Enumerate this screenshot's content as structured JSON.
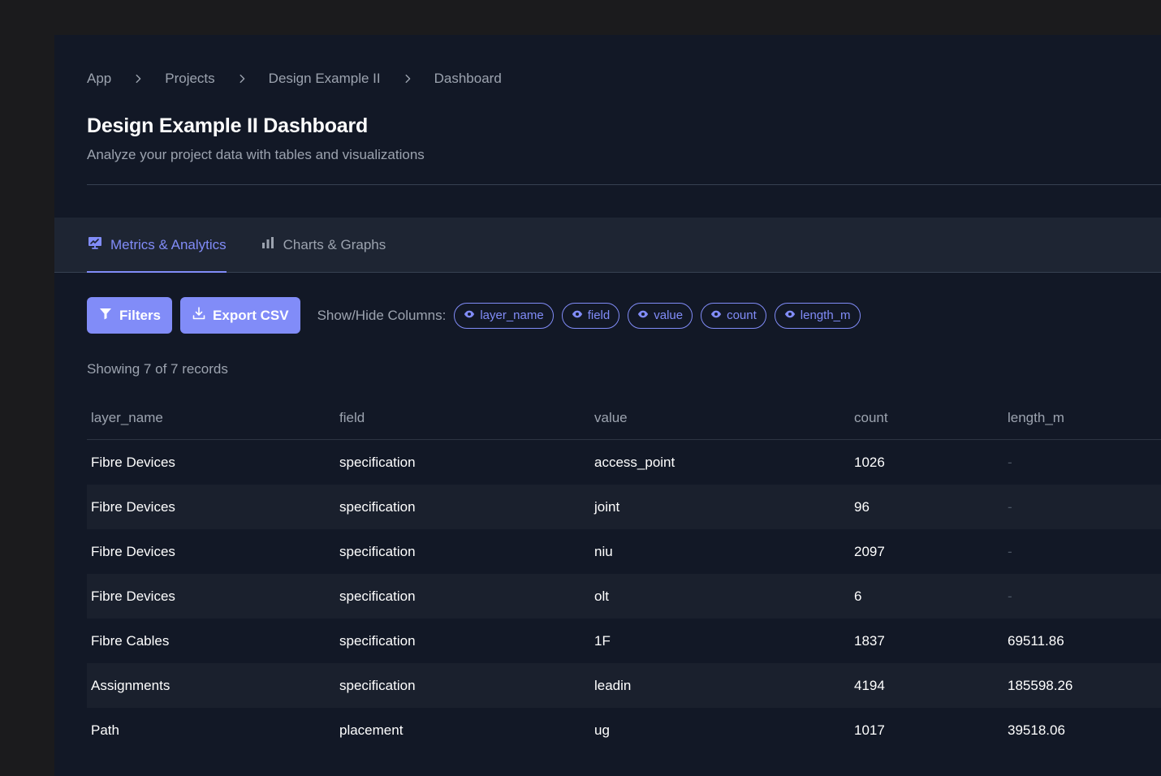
{
  "breadcrumb": [
    "App",
    "Projects",
    "Design Example II",
    "Dashboard"
  ],
  "page": {
    "title": "Design Example II Dashboard",
    "subtitle": "Analyze your project data with tables and visualizations"
  },
  "tabs": [
    {
      "label": "Metrics & Analytics",
      "active": true,
      "icon": "presentation-chart-icon"
    },
    {
      "label": "Charts & Graphs",
      "active": false,
      "icon": "bar-chart-icon"
    }
  ],
  "toolbar": {
    "filters_label": "Filters",
    "export_label": "Export CSV",
    "show_hide_label": "Show/Hide Columns:",
    "column_toggles": [
      "layer_name",
      "field",
      "value",
      "count",
      "length_m"
    ]
  },
  "records_text": "Showing 7 of 7 records",
  "table": {
    "columns": [
      "layer_name",
      "field",
      "value",
      "count",
      "length_m"
    ],
    "rows": [
      [
        "Fibre Devices",
        "specification",
        "access_point",
        "1026",
        "-"
      ],
      [
        "Fibre Devices",
        "specification",
        "joint",
        "96",
        "-"
      ],
      [
        "Fibre Devices",
        "specification",
        "niu",
        "2097",
        "-"
      ],
      [
        "Fibre Devices",
        "specification",
        "olt",
        "6",
        "-"
      ],
      [
        "Fibre Cables",
        "specification",
        "1F",
        "1837",
        "69511.86"
      ],
      [
        "Assignments",
        "specification",
        "leadin",
        "4194",
        "185598.26"
      ],
      [
        "Path",
        "placement",
        "ug",
        "1017",
        "39518.06"
      ]
    ]
  },
  "colors": {
    "accent": "#818cf8",
    "background": "#121826",
    "outer_background": "#1b1b1d",
    "tabbar": "#1e2533"
  }
}
